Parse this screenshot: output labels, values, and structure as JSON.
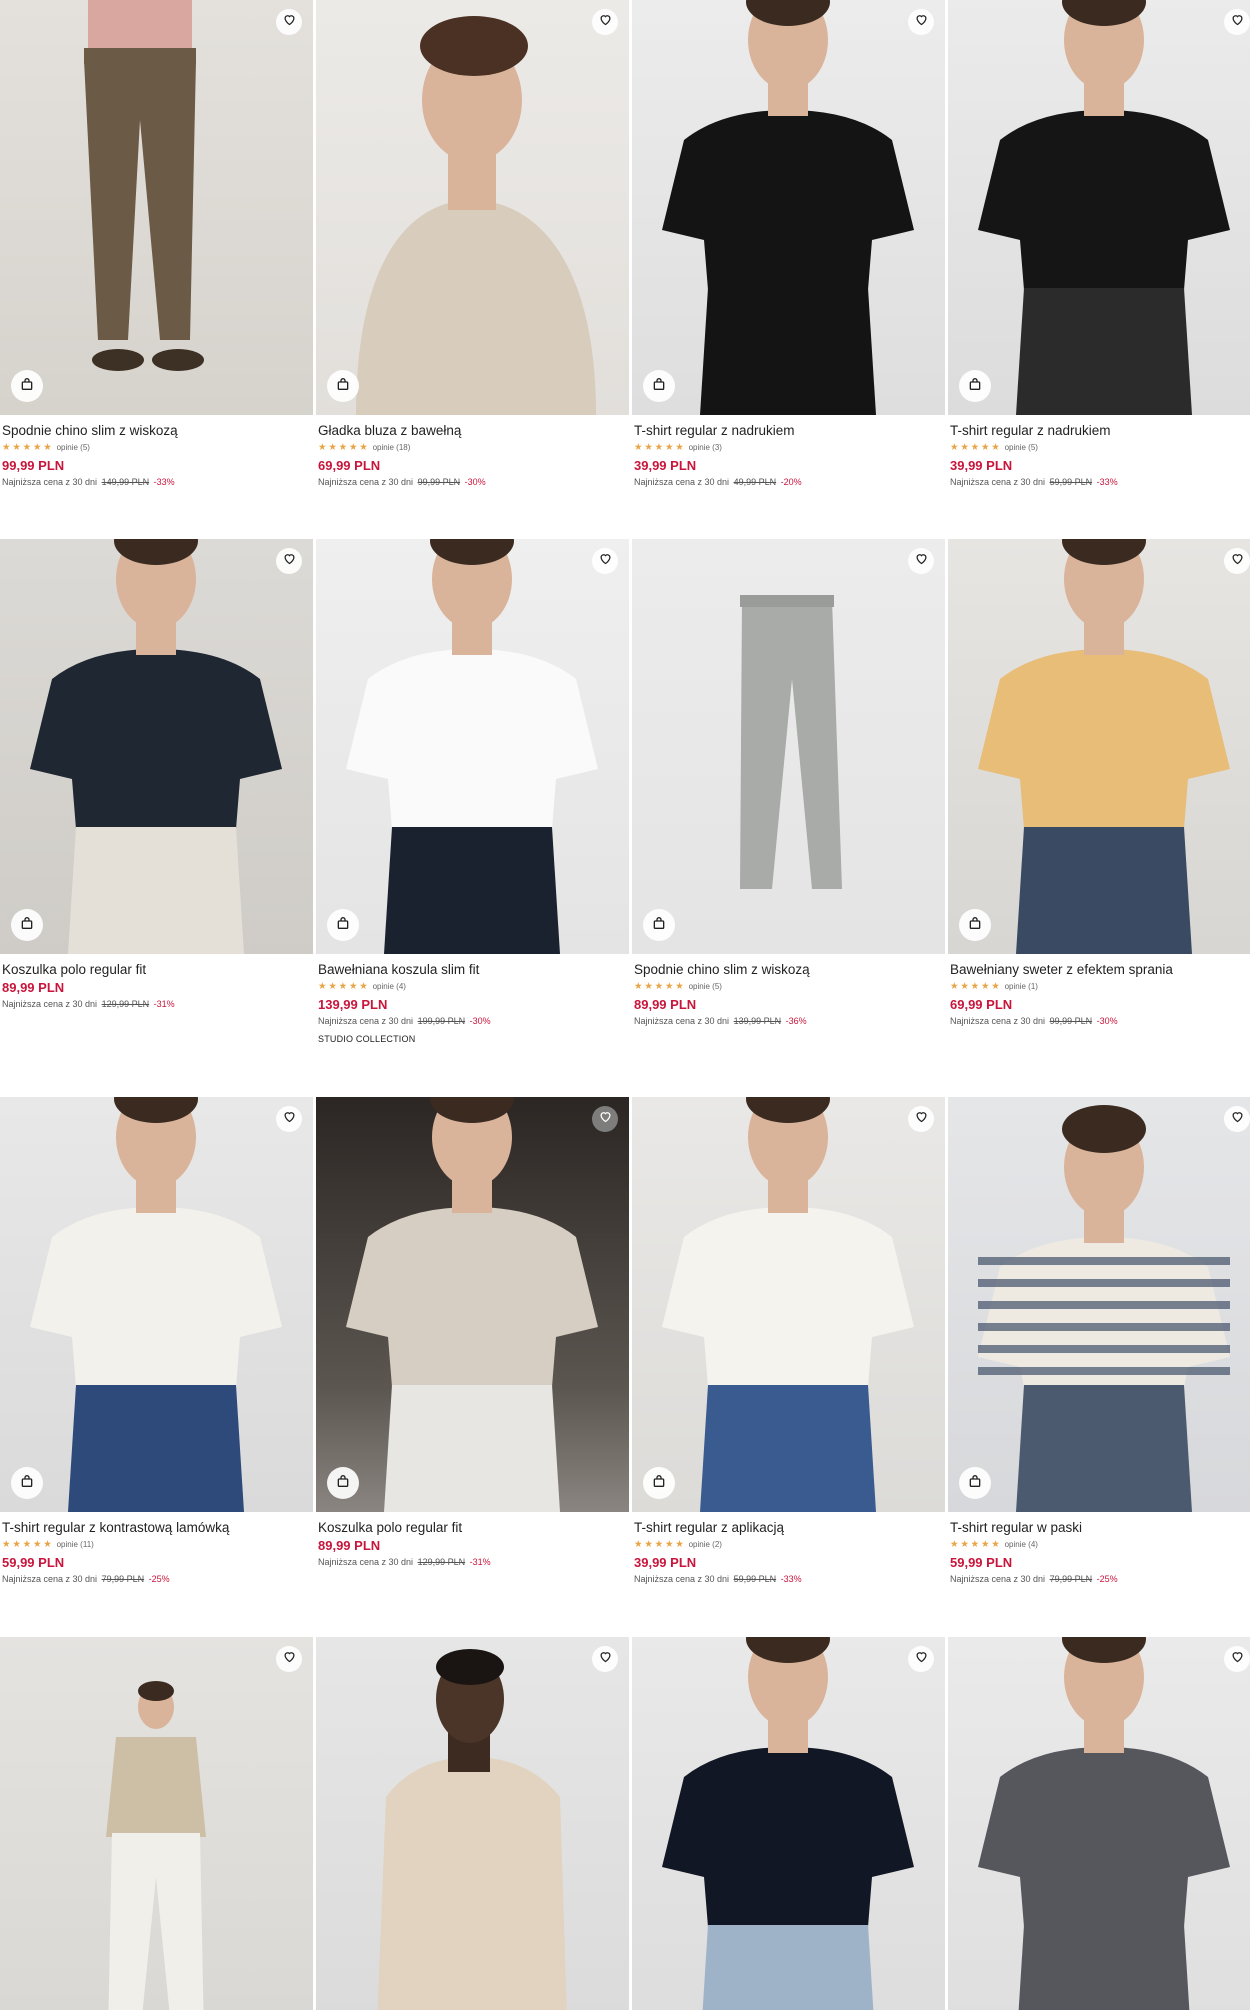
{
  "colors": {
    "price": "#c8153b",
    "star": "#e8a547"
  },
  "icons": {
    "favorite": "heart-icon",
    "cart": "shopping-bag-icon"
  },
  "rows": [
    {
      "products": [
        {
          "name": "Spodnie chino slim z wiskozą",
          "stars": "★★★★★",
          "reviews": "opinie (5)",
          "price": "99,99 PLN",
          "lowest_label": "Najniższa cena z 30 dni",
          "old_price": "149,99 PLN",
          "discount": "-33%",
          "bg": "linear-gradient(180deg,#e4e1dd,#d6d2cc)",
          "fig": "pants",
          "c1": "#d9a79f",
          "c2": "#6b5a45"
        },
        {
          "name": "Gładka bluza z bawełną",
          "stars": "★★★★★",
          "reviews": "opinie (18)",
          "price": "69,99 PLN",
          "lowest_label": "Najniższa cena z 30 dni",
          "old_price": "99,99 PLN",
          "discount": "-30%",
          "bg": "linear-gradient(180deg,#eceae7,#e2dfdb)",
          "fig": "portrait",
          "c1": "#d8cdbc",
          "c2": "#d8cdbc"
        },
        {
          "name": "T-shirt regular z nadrukiem",
          "stars": "★★★★★",
          "reviews": "opinie (3)",
          "price": "39,99 PLN",
          "lowest_label": "Najniższa cena z 30 dni",
          "old_price": "49,99 PLN",
          "discount": "-20%",
          "bg": "linear-gradient(180deg,#ececec,#dedede)",
          "fig": "tee",
          "c1": "#141414",
          "c2": "#141414"
        },
        {
          "name": "T-shirt regular z nadrukiem",
          "stars": "★★★★★",
          "reviews": "opinie (5)",
          "price": "39,99 PLN",
          "lowest_label": "Najniższa cena z 30 dni",
          "old_price": "59,99 PLN",
          "discount": "-33%",
          "bg": "linear-gradient(180deg,#ebebeb,#dcdcdc)",
          "fig": "tee",
          "c1": "#151515",
          "c2": "#2b2b2b"
        }
      ]
    },
    {
      "products": [
        {
          "name": "Koszulka polo regular fit",
          "stars": "",
          "reviews": "",
          "price": "89,99 PLN",
          "lowest_label": "Najniższa cena z 30 dni",
          "old_price": "129,99 PLN",
          "discount": "-31%",
          "bg": "linear-gradient(180deg,#dcdad6,#cfccc7)",
          "fig": "tee",
          "c1": "#1f2733",
          "c2": "#e4e0d8"
        },
        {
          "name": "Bawełniana koszula slim fit",
          "stars": "★★★★★",
          "reviews": "opinie (4)",
          "price": "139,99 PLN",
          "lowest_label": "Najniższa cena z 30 dni",
          "old_price": "199,99 PLN",
          "discount": "-30%",
          "collection": "STUDIO COLLECTION",
          "bg": "linear-gradient(180deg,#efefef,#e4e4e4)",
          "fig": "tee",
          "c1": "#fafafa",
          "c2": "#1a2230"
        },
        {
          "name": "Spodnie chino slim z wiskozą",
          "stars": "★★★★★",
          "reviews": "opinie (5)",
          "price": "89,99 PLN",
          "lowest_label": "Najniższa cena z 30 dni",
          "old_price": "139,99 PLN",
          "discount": "-36%",
          "bg": "linear-gradient(180deg,#ececec,#e4e4e4)",
          "fig": "flatpants",
          "c1": "#a9aba8",
          "c2": "#a9aba8"
        },
        {
          "name": "Bawełniany sweter z efektem sprania",
          "stars": "★★★★★",
          "reviews": "opinie (1)",
          "price": "69,99 PLN",
          "lowest_label": "Najniższa cena z 30 dni",
          "old_price": "99,99 PLN",
          "discount": "-30%",
          "bg": "linear-gradient(180deg,#e6e5e2,#d8d6d2)",
          "fig": "tee",
          "c1": "#e7bd78",
          "c2": "#3a4a63"
        }
      ]
    },
    {
      "products": [
        {
          "name": "T-shirt regular z kontrastową lamówką",
          "stars": "★★★★★",
          "reviews": "opinie (11)",
          "price": "59,99 PLN",
          "lowest_label": "Najniższa cena z 30 dni",
          "old_price": "79,99 PLN",
          "discount": "-25%",
          "bg": "linear-gradient(180deg,#e8e8e8,#dadada)",
          "fig": "tee",
          "c1": "#f3f1ec",
          "c2": "#2d4a7a"
        },
        {
          "name": "Koszulka polo regular fit",
          "stars": "",
          "reviews": "",
          "price": "89,99 PLN",
          "lowest_label": "Najniższa cena z 30 dni",
          "old_price": "129,99 PLN",
          "discount": "-31%",
          "bg": "linear-gradient(180deg,#2b2623,#5b5650 70%,#8a8580)",
          "fig": "tee",
          "c1": "#d6cec2",
          "c2": "#e8e6e2",
          "fav_dark": true
        },
        {
          "name": "T-shirt regular z aplikacją",
          "stars": "★★★★★",
          "reviews": "opinie (2)",
          "price": "39,99 PLN",
          "lowest_label": "Najniższa cena z 30 dni",
          "old_price": "59,99 PLN",
          "discount": "-33%",
          "bg": "linear-gradient(180deg,#e9e8e6,#dcdbd8)",
          "fig": "tee",
          "c1": "#f5f3ee",
          "c2": "#3a5b8f"
        },
        {
          "name": "T-shirt regular w paski",
          "stars": "★★★★★",
          "reviews": "opinie (4)",
          "price": "59,99 PLN",
          "lowest_label": "Najniższa cena z 30 dni",
          "old_price": "79,99 PLN",
          "discount": "-25%",
          "bg": "linear-gradient(180deg,#e5e6e8,#d7d8db)",
          "fig": "stripes",
          "c1": "#eeeae2",
          "c2": "#4c5a70"
        }
      ]
    },
    {
      "products": [
        {
          "bg": "linear-gradient(180deg,#e4e3e0,#d9d7d3)",
          "fig": "small",
          "c1": "#cdbfa6",
          "c2": "#f1efea"
        },
        {
          "bg": "linear-gradient(180deg,#e6e6e6,#dadada)",
          "fig": "jacket",
          "c1": "#e1d3bf",
          "c2": "#e1d3bf"
        },
        {
          "bg": "linear-gradient(180deg,#e9e9e9,#dcdcdc)",
          "fig": "tee",
          "c1": "#121725",
          "c2": "#9fb3c8"
        },
        {
          "bg": "linear-gradient(180deg,#eaeaea,#dedede)",
          "fig": "tee",
          "c1": "#55575c",
          "c2": "#55575c"
        }
      ]
    }
  ]
}
